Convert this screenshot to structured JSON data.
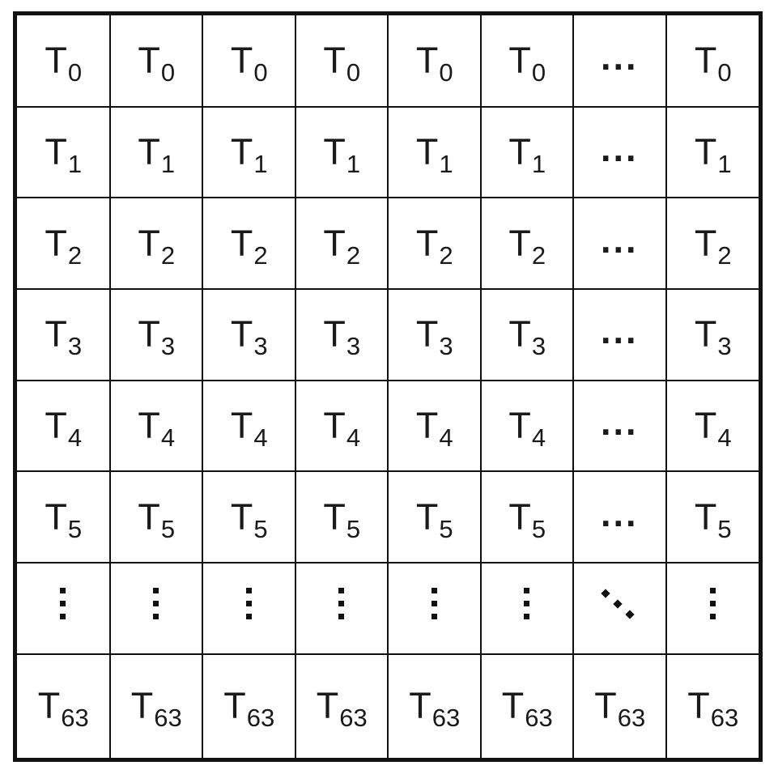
{
  "figure": {
    "kind": "thread-block-grid",
    "columns": 8,
    "rows": 8,
    "colors": {
      "border": "#111111",
      "cell_background": "#ffffff",
      "text": "#1a1a1a"
    }
  },
  "labels": {
    "t0": {
      "base": "T",
      "sub": "0"
    },
    "t1": {
      "base": "T",
      "sub": "1"
    },
    "t2": {
      "base": "T",
      "sub": "2"
    },
    "t3": {
      "base": "T",
      "sub": "3"
    },
    "t4": {
      "base": "T",
      "sub": "4"
    },
    "t5": {
      "base": "T",
      "sub": "5"
    },
    "t63": {
      "base": "T",
      "sub": "63"
    },
    "ellipsis_horizontal": "...",
    "ellipsis_vertical": "⋮",
    "ellipsis_diagonal": "⋱"
  },
  "grid": {
    "rows": [
      {
        "id": "row-t0",
        "label": "T0",
        "cells": [
          {
            "type": "thread",
            "base": "T",
            "sub": "0"
          },
          {
            "type": "thread",
            "base": "T",
            "sub": "0"
          },
          {
            "type": "thread",
            "base": "T",
            "sub": "0"
          },
          {
            "type": "thread",
            "base": "T",
            "sub": "0"
          },
          {
            "type": "thread",
            "base": "T",
            "sub": "0"
          },
          {
            "type": "thread",
            "base": "T",
            "sub": "0"
          },
          {
            "type": "ellipsis-h",
            "text": "..."
          },
          {
            "type": "thread",
            "base": "T",
            "sub": "0"
          }
        ]
      },
      {
        "id": "row-t1",
        "label": "T1",
        "cells": [
          {
            "type": "thread",
            "base": "T",
            "sub": "1"
          },
          {
            "type": "thread",
            "base": "T",
            "sub": "1"
          },
          {
            "type": "thread",
            "base": "T",
            "sub": "1"
          },
          {
            "type": "thread",
            "base": "T",
            "sub": "1"
          },
          {
            "type": "thread",
            "base": "T",
            "sub": "1"
          },
          {
            "type": "thread",
            "base": "T",
            "sub": "1"
          },
          {
            "type": "ellipsis-h",
            "text": "..."
          },
          {
            "type": "thread",
            "base": "T",
            "sub": "1"
          }
        ]
      },
      {
        "id": "row-t2",
        "label": "T2",
        "cells": [
          {
            "type": "thread",
            "base": "T",
            "sub": "2"
          },
          {
            "type": "thread",
            "base": "T",
            "sub": "2"
          },
          {
            "type": "thread",
            "base": "T",
            "sub": "2"
          },
          {
            "type": "thread",
            "base": "T",
            "sub": "2"
          },
          {
            "type": "thread",
            "base": "T",
            "sub": "2"
          },
          {
            "type": "thread",
            "base": "T",
            "sub": "2"
          },
          {
            "type": "ellipsis-h",
            "text": "..."
          },
          {
            "type": "thread",
            "base": "T",
            "sub": "2"
          }
        ]
      },
      {
        "id": "row-t3",
        "label": "T3",
        "cells": [
          {
            "type": "thread",
            "base": "T",
            "sub": "3"
          },
          {
            "type": "thread",
            "base": "T",
            "sub": "3"
          },
          {
            "type": "thread",
            "base": "T",
            "sub": "3"
          },
          {
            "type": "thread",
            "base": "T",
            "sub": "3"
          },
          {
            "type": "thread",
            "base": "T",
            "sub": "3"
          },
          {
            "type": "thread",
            "base": "T",
            "sub": "3"
          },
          {
            "type": "ellipsis-h",
            "text": "..."
          },
          {
            "type": "thread",
            "base": "T",
            "sub": "3"
          }
        ]
      },
      {
        "id": "row-t4",
        "label": "T4",
        "cells": [
          {
            "type": "thread",
            "base": "T",
            "sub": "4"
          },
          {
            "type": "thread",
            "base": "T",
            "sub": "4"
          },
          {
            "type": "thread",
            "base": "T",
            "sub": "4"
          },
          {
            "type": "thread",
            "base": "T",
            "sub": "4"
          },
          {
            "type": "thread",
            "base": "T",
            "sub": "4"
          },
          {
            "type": "thread",
            "base": "T",
            "sub": "4"
          },
          {
            "type": "ellipsis-h",
            "text": "..."
          },
          {
            "type": "thread",
            "base": "T",
            "sub": "4"
          }
        ]
      },
      {
        "id": "row-t5",
        "label": "T5",
        "cells": [
          {
            "type": "thread",
            "base": "T",
            "sub": "5"
          },
          {
            "type": "thread",
            "base": "T",
            "sub": "5"
          },
          {
            "type": "thread",
            "base": "T",
            "sub": "5"
          },
          {
            "type": "thread",
            "base": "T",
            "sub": "5"
          },
          {
            "type": "thread",
            "base": "T",
            "sub": "5"
          },
          {
            "type": "thread",
            "base": "T",
            "sub": "5"
          },
          {
            "type": "ellipsis-h",
            "text": "..."
          },
          {
            "type": "thread",
            "base": "T",
            "sub": "5"
          }
        ]
      },
      {
        "id": "row-ellipsis",
        "label": "vertical ellipsis row",
        "cells": [
          {
            "type": "ellipsis-v",
            "text": "⋮"
          },
          {
            "type": "ellipsis-v",
            "text": "⋮"
          },
          {
            "type": "ellipsis-v",
            "text": "⋮"
          },
          {
            "type": "ellipsis-v",
            "text": "⋮"
          },
          {
            "type": "ellipsis-v",
            "text": "⋮"
          },
          {
            "type": "ellipsis-v",
            "text": "⋮"
          },
          {
            "type": "ellipsis-d",
            "text": "⋱"
          },
          {
            "type": "ellipsis-v",
            "text": "⋮"
          }
        ]
      },
      {
        "id": "row-t63",
        "label": "T63",
        "cells": [
          {
            "type": "thread",
            "base": "T",
            "sub": "63"
          },
          {
            "type": "thread",
            "base": "T",
            "sub": "63"
          },
          {
            "type": "thread",
            "base": "T",
            "sub": "63"
          },
          {
            "type": "thread",
            "base": "T",
            "sub": "63"
          },
          {
            "type": "thread",
            "base": "T",
            "sub": "63"
          },
          {
            "type": "thread",
            "base": "T",
            "sub": "63"
          },
          {
            "type": "thread",
            "base": "T",
            "sub": "63"
          },
          {
            "type": "thread",
            "base": "T",
            "sub": "63"
          }
        ]
      }
    ]
  }
}
